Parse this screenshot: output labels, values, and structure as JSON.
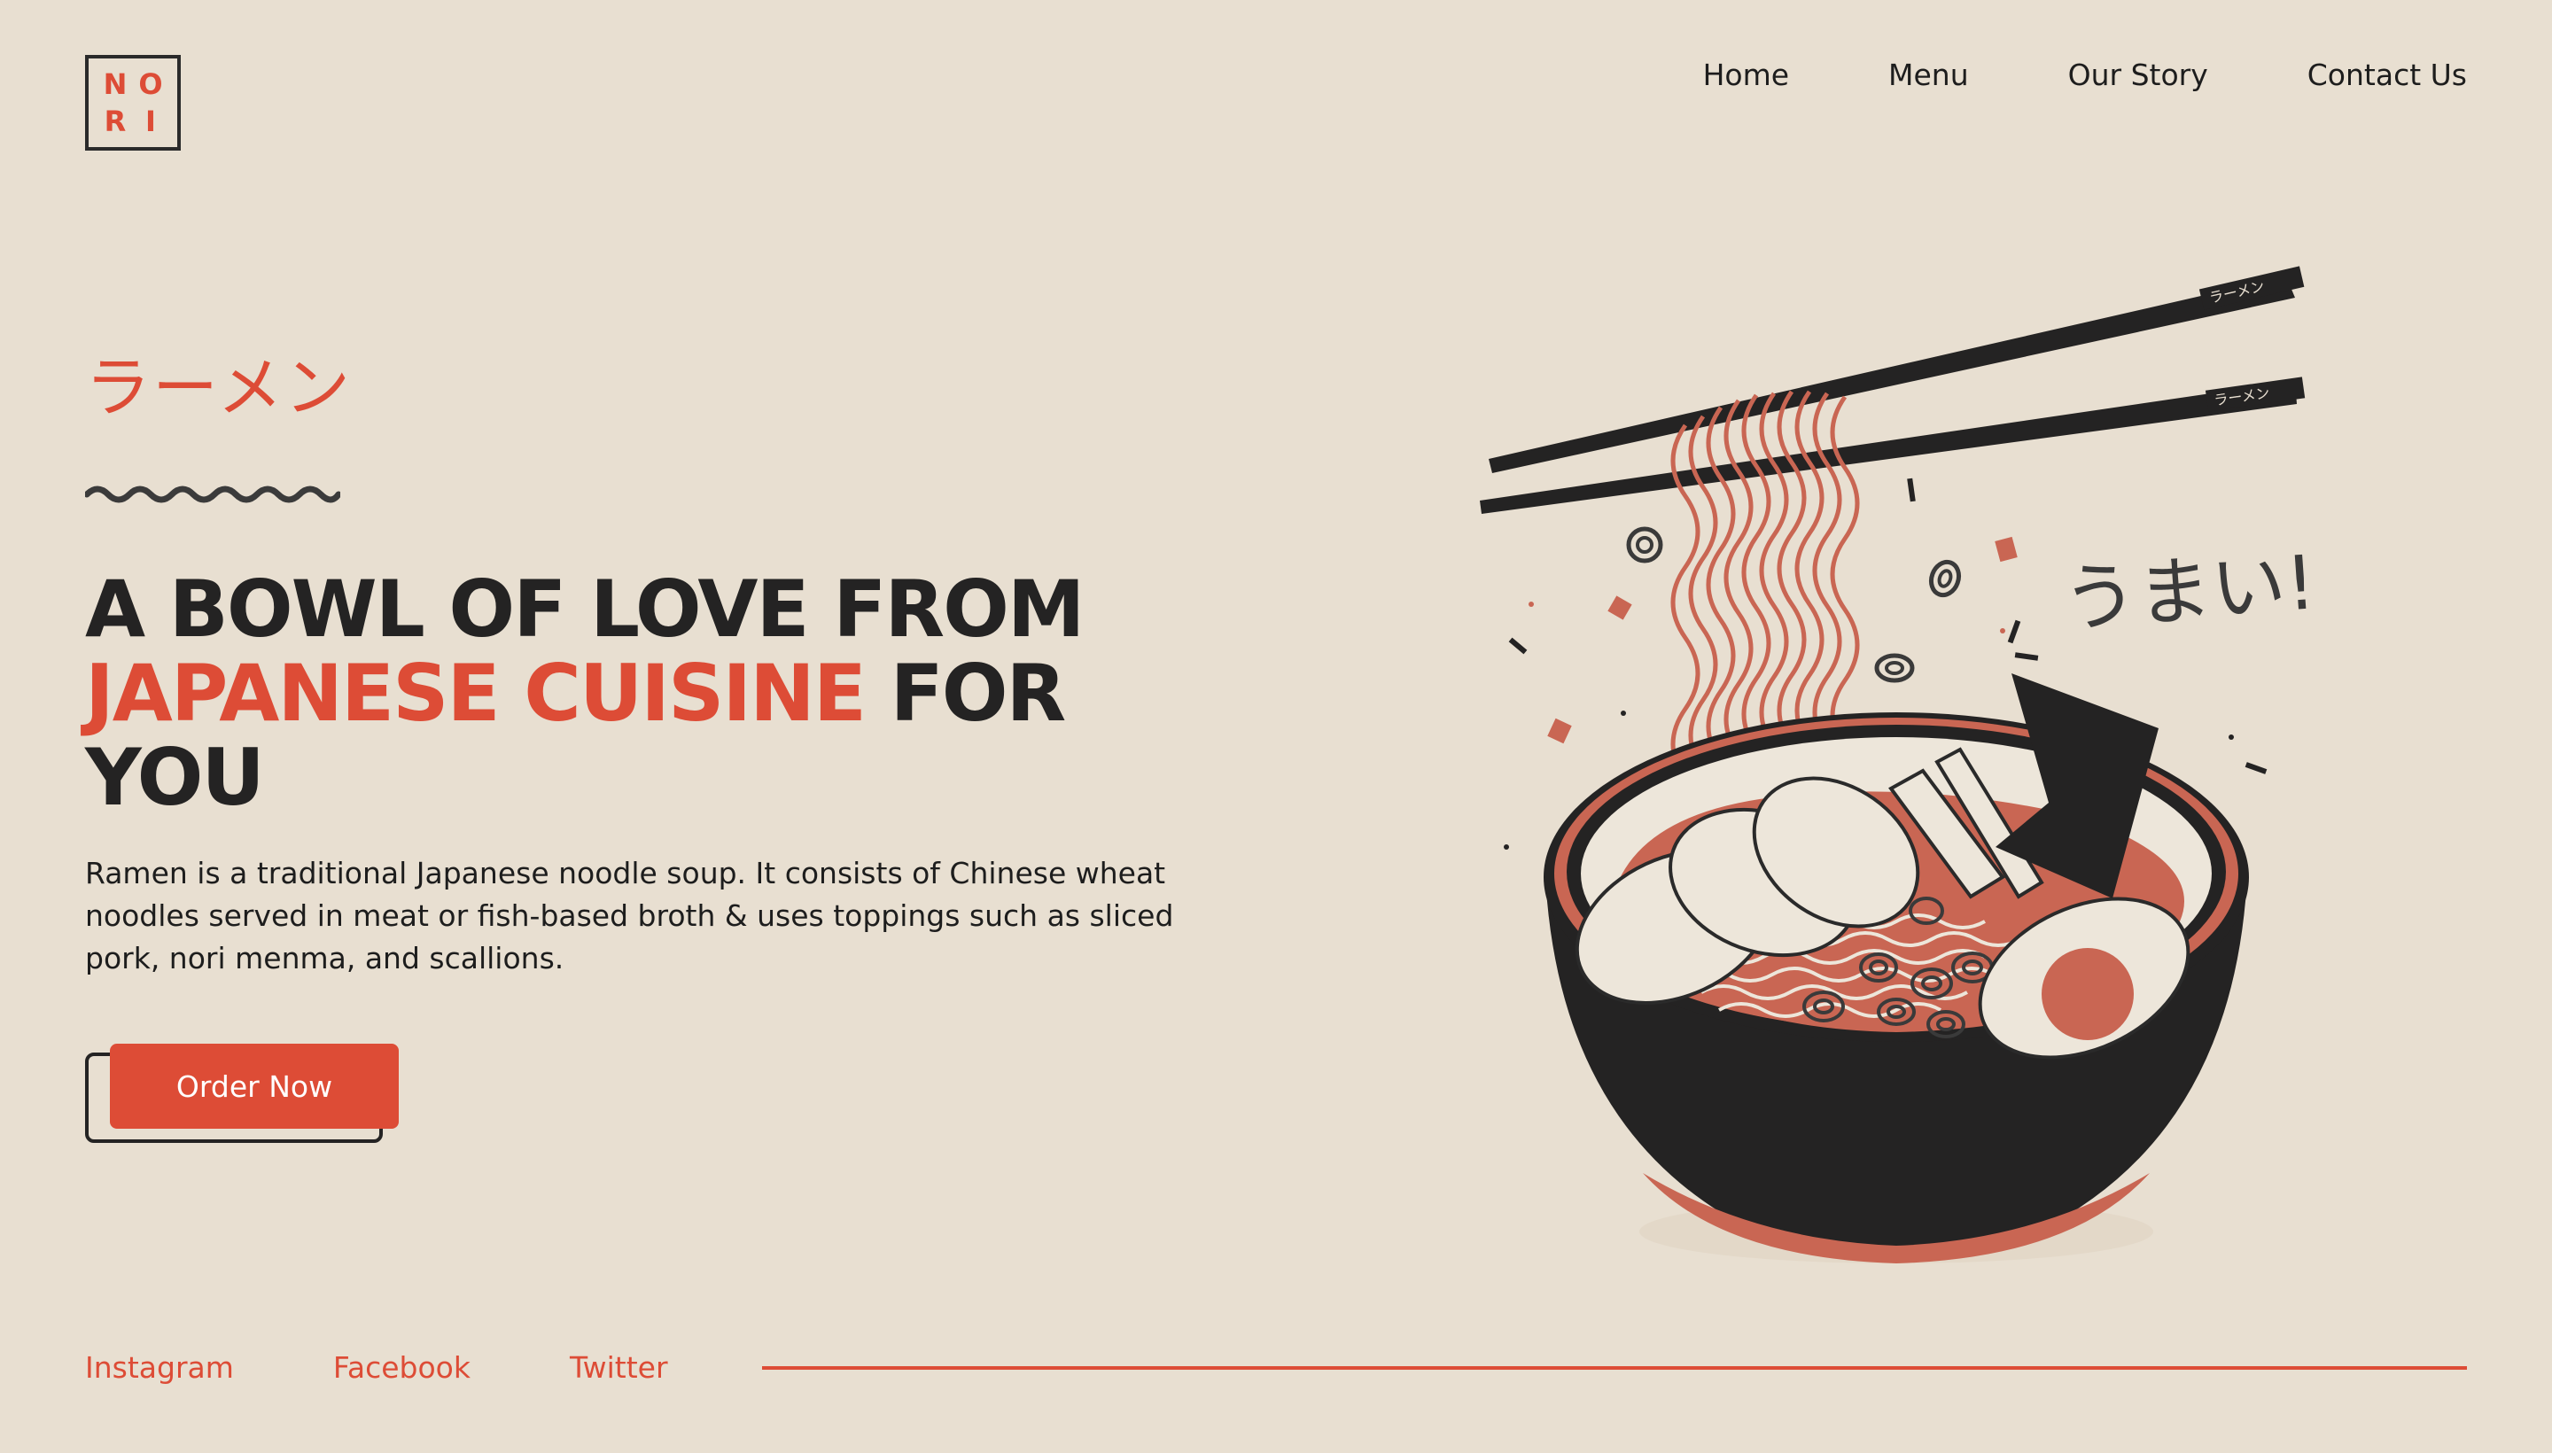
{
  "brand": {
    "logo_letters": [
      "N",
      "O",
      "R",
      "I"
    ],
    "accent_color": "#dd4c36",
    "text_color": "#242323",
    "background_color": "#e8dfd1"
  },
  "nav": {
    "items": [
      {
        "label": "Home"
      },
      {
        "label": "Menu"
      },
      {
        "label": "Our Story"
      },
      {
        "label": "Contact Us"
      }
    ]
  },
  "hero": {
    "jp_title": "ラーメン",
    "headline_part1": "A BOWL OF LOVE FROM",
    "headline_accent": "JAPANESE CUISINE",
    "headline_part2": "FOR YOU",
    "description": "Ramen is a traditional Japanese noodle soup. It consists of Chinese wheat noodles served in meat or fish-based broth & uses toppings such as sliced pork, nori menma, and scallions.",
    "cta_label": "Order Now"
  },
  "illustration": {
    "chopstick_label": "ラーメン",
    "exclaim_text": "うまい!"
  },
  "footer": {
    "social": [
      {
        "label": "Instagram"
      },
      {
        "label": "Facebook"
      },
      {
        "label": "Twitter"
      }
    ]
  }
}
